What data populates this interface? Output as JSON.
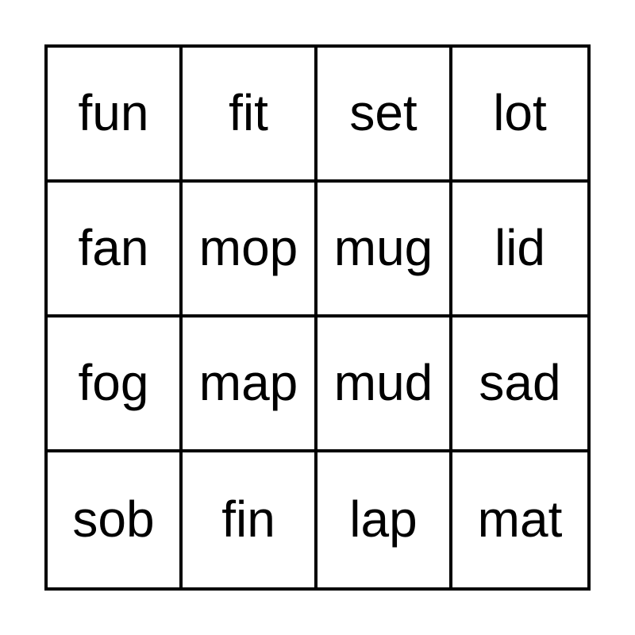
{
  "board": {
    "rows": [
      [
        "fun",
        "fit",
        "set",
        "lot"
      ],
      [
        "fan",
        "mop",
        "mug",
        "lid"
      ],
      [
        "fog",
        "map",
        "mud",
        "sad"
      ],
      [
        "sob",
        "fin",
        "lap",
        "mat"
      ]
    ]
  }
}
